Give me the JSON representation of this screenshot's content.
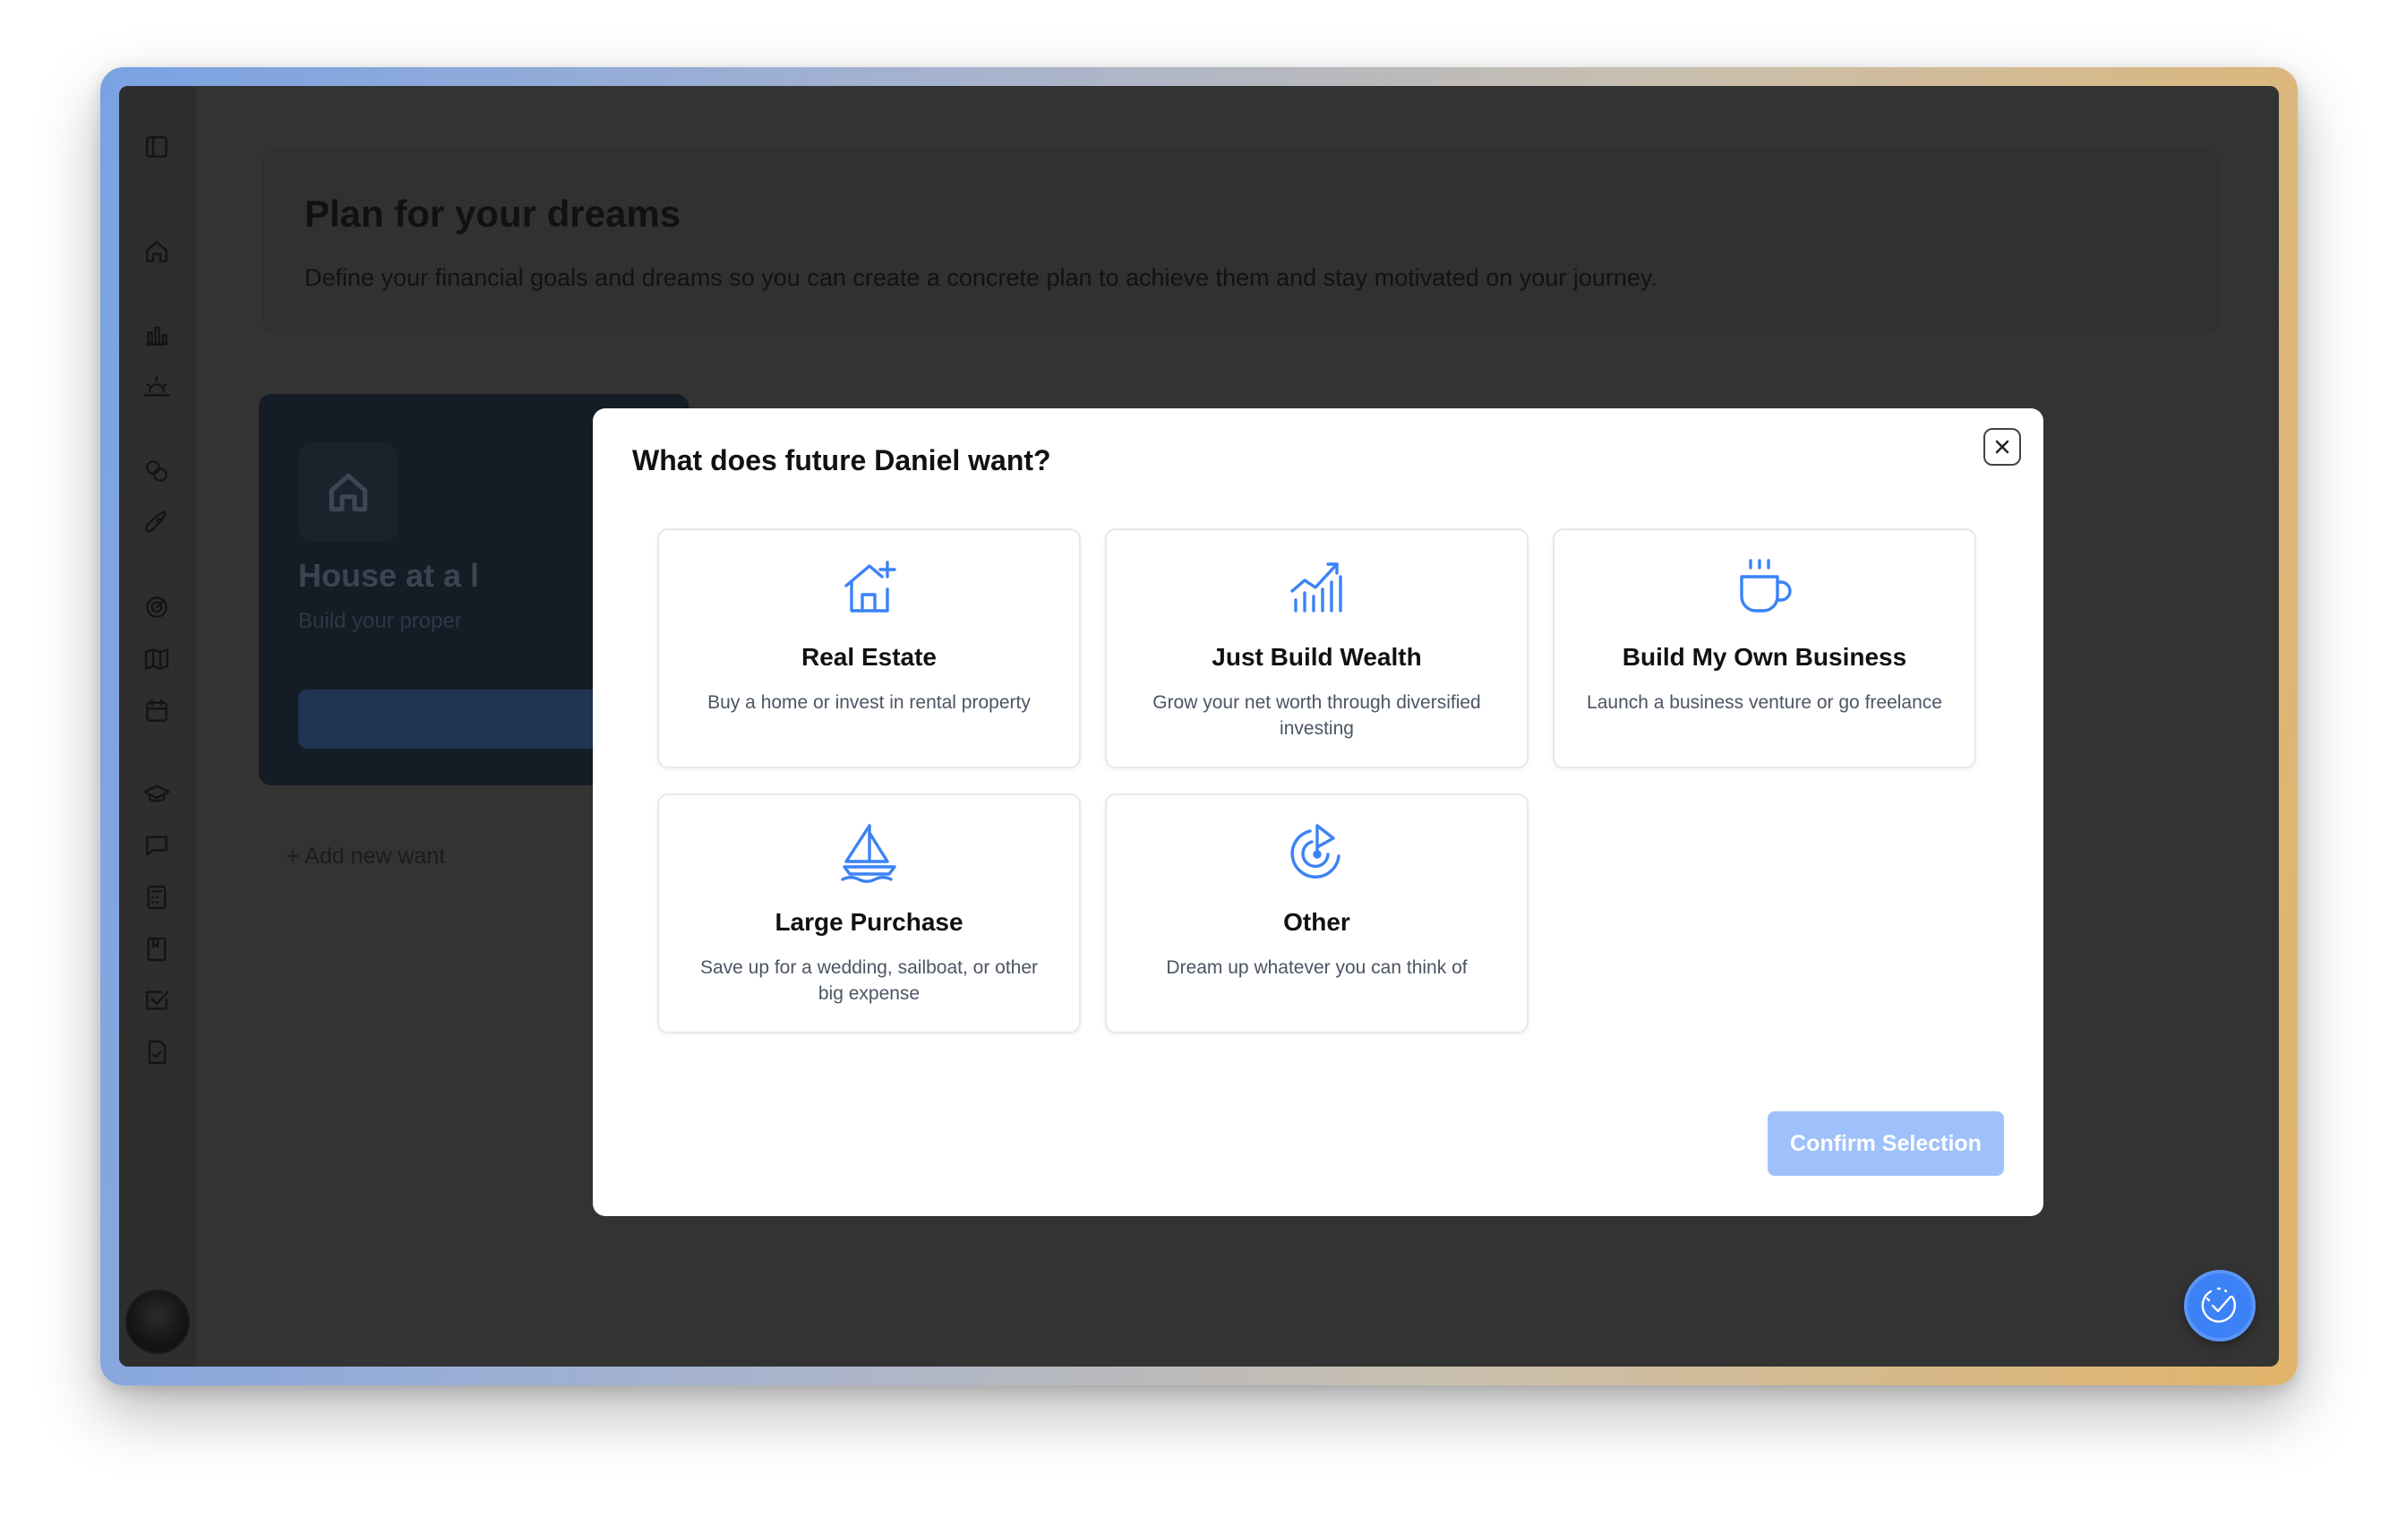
{
  "page": {
    "title": "Plan for your dreams",
    "subtitle": "Define your financial goals and dreams so you can create a concrete plan to achieve them and stay motivated on your journey."
  },
  "want_card": {
    "title": "House at a l",
    "subtitle": "Build your proper",
    "icon": "home-icon"
  },
  "add_new": "+ Add new want",
  "sidebar": {
    "icons": [
      "panel-toggle-icon",
      "home-icon",
      "bar-chart-icon",
      "sunrise-icon",
      "coins-icon",
      "rocket-icon",
      "target-icon",
      "map-icon",
      "calendar-icon",
      "graduation-cap-icon",
      "message-icon",
      "calculator-icon",
      "book-icon",
      "checkbox-icon",
      "file-check-icon"
    ]
  },
  "modal": {
    "title": "What does future Daniel want?",
    "confirm_label": "Confirm Selection",
    "options": [
      {
        "title": "Real Estate",
        "desc": "Buy a home or invest in rental property",
        "icon": "house-plus-icon"
      },
      {
        "title": "Just Build Wealth",
        "desc": "Grow your net worth through diversified investing",
        "icon": "chart-growth-icon"
      },
      {
        "title": "Build My Own Business",
        "desc": "Launch a business venture or go freelance",
        "icon": "coffee-cup-icon"
      },
      {
        "title": "Large Purchase",
        "desc": "Save up for a wedding, sailboat, or other big expense",
        "icon": "sailboat-icon"
      },
      {
        "title": "Other",
        "desc": "Dream up whatever you can think of",
        "icon": "target-arrow-icon"
      }
    ]
  },
  "colors": {
    "accent": "#3b82f6",
    "confirm_disabled": "#9ec1fb",
    "overlay": "#333333"
  }
}
